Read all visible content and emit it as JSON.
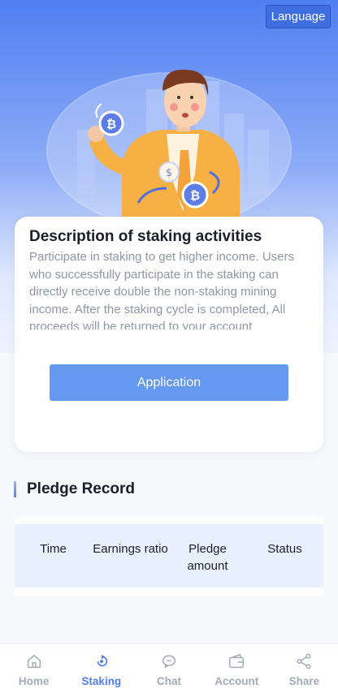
{
  "header": {
    "language_label": "Language"
  },
  "staking": {
    "title": "Description of staking activities",
    "description": "Participate in staking to get higher income. Users who successfully participate in the staking can directly receive double the non-staking mining income. After the staking cycle is completed, All proceeds will be returned to your account",
    "apply_label": "Application"
  },
  "pledge": {
    "title": "Pledge Record",
    "columns": [
      "Time",
      "Earnings ratio",
      "Pledge amount",
      "Status"
    ]
  },
  "tabbar": {
    "items": [
      {
        "label": "Home",
        "icon": "home-icon",
        "active": false
      },
      {
        "label": "Staking",
        "icon": "staking-icon",
        "active": true
      },
      {
        "label": "Chat",
        "icon": "chat-icon",
        "active": false
      },
      {
        "label": "Account",
        "icon": "wallet-icon",
        "active": false
      },
      {
        "label": "Share",
        "icon": "share-icon",
        "active": false
      }
    ]
  },
  "colors": {
    "accent": "#4f7ff1",
    "button": "#6599ef",
    "table_header": "#e8effd"
  }
}
